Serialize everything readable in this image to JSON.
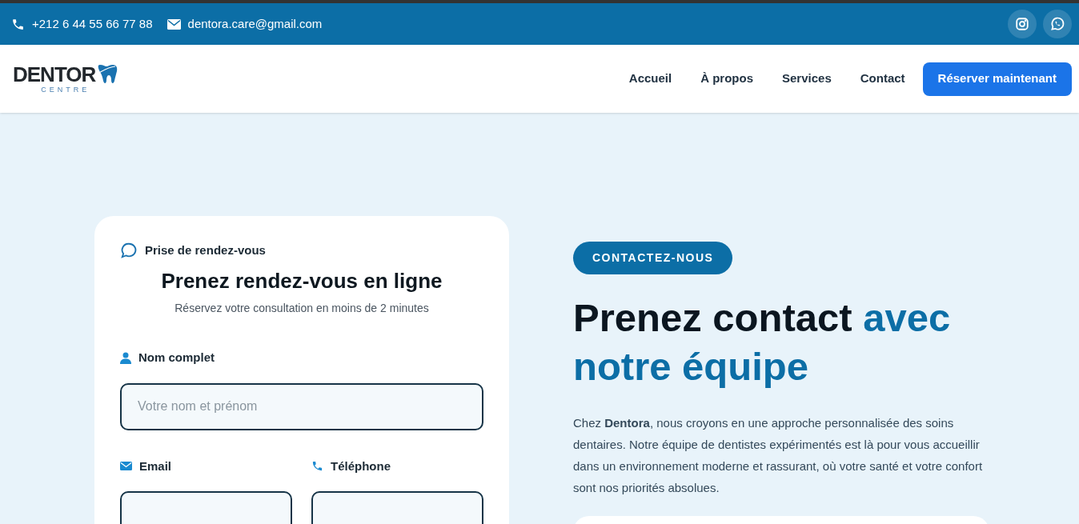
{
  "top_bar": {
    "phone": "+212 6 44 55 66 77 88",
    "email": "dentora.care@gmail.com"
  },
  "logo": {
    "name": "DENTOR",
    "subtitle": "CENTRE"
  },
  "nav": {
    "links": [
      {
        "label": "Accueil"
      },
      {
        "label": "À propos"
      },
      {
        "label": "Services"
      },
      {
        "label": "Contact"
      }
    ],
    "cta": "Réserver maintenant"
  },
  "form_card": {
    "eyebrow": "Prise de rendez-vous",
    "title": "Prenez rendez-vous en ligne",
    "subtitle": "Réservez votre consultation en moins de 2 minutes",
    "fields": [
      {
        "kind": "name",
        "label": "Nom complet",
        "placeholder": "Votre nom et prénom"
      },
      {
        "kind": "email",
        "label": "Email"
      },
      {
        "kind": "phone",
        "label": "Téléphone"
      }
    ]
  },
  "contact": {
    "badge": "CONTACTEZ-NOUS",
    "title": "Prenez contact ",
    "title_accent": "avec notre équipe",
    "text": "Chez **Dentora**, nous croyons en une approche personnalisée des soins dentaires. Notre équipe de dentistes expérimentés est là pour vous accueillir dans un environnement moderne et rassurant, où votre santé et votre confort sont nos priorités absolues."
  }
}
